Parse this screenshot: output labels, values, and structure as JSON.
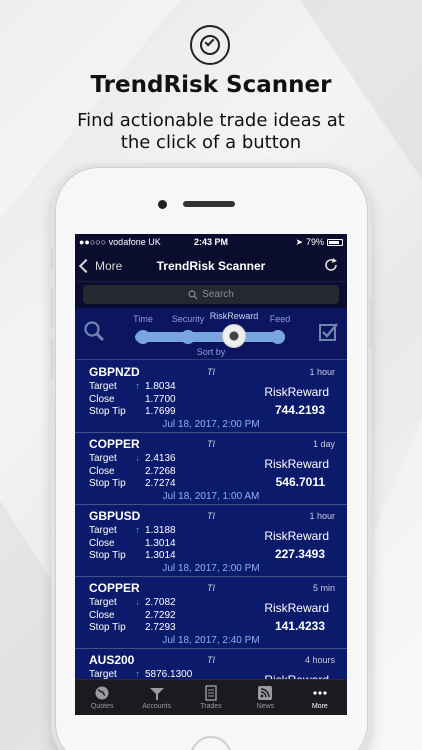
{
  "promo": {
    "title": "TrendRisk Scanner",
    "subtitle": "Find actionable trade ideas at the click of a button"
  },
  "status": {
    "carrier": "●●○○○ vodafone UK",
    "time": "2:43 PM",
    "battery": "79%"
  },
  "nav": {
    "back_label": "More",
    "title": "TrendRisk Scanner"
  },
  "search": {
    "placeholder": "Search"
  },
  "sort": {
    "options": [
      "Time",
      "Security",
      "RiskReward",
      "Feed"
    ],
    "selected": "RiskReward",
    "caption": "Sort by"
  },
  "trades": [
    {
      "name": "GBPNZD",
      "ti": "TI",
      "period": "1 hour",
      "direction": "up",
      "target_label": "Target",
      "target": "1.8034",
      "close_label": "Close",
      "close": "1.7700",
      "stop_label": "Stop Tip",
      "stop": "1.7699",
      "rr_label": "RiskReward",
      "rr": "744.2193",
      "date": "Jul 18, 2017, 2:00 PM"
    },
    {
      "name": "COPPER",
      "ti": "TI",
      "period": "1 day",
      "direction": "down",
      "target_label": "Target",
      "target": "2.4136",
      "close_label": "Close",
      "close": "2.7268",
      "stop_label": "Stop Tip",
      "stop": "2.7274",
      "rr_label": "RiskReward",
      "rr": "546.7011",
      "date": "Jul 18, 2017, 1:00 AM"
    },
    {
      "name": "GBPUSD",
      "ti": "TI",
      "period": "1 hour",
      "direction": "up",
      "target_label": "Target",
      "target": "1.3188",
      "close_label": "Close",
      "close": "1.3014",
      "stop_label": "Stop Tip",
      "stop": "1.3014",
      "rr_label": "RiskReward",
      "rr": "227.3493",
      "date": "Jul 18, 2017, 2:00 PM"
    },
    {
      "name": "COPPER",
      "ti": "TI",
      "period": "5 min",
      "direction": "down",
      "target_label": "Target",
      "target": "2.7082",
      "close_label": "Close",
      "close": "2.7292",
      "stop_label": "Stop Tip",
      "stop": "2.7293",
      "rr_label": "RiskReward",
      "rr": "141.4233",
      "date": "Jul 18, 2017, 2:40 PM"
    },
    {
      "name": "AUS200",
      "ti": "TI",
      "period": "4 hours",
      "direction": "up",
      "target_label": "Target",
      "target": "5876.1300",
      "close_label": "",
      "close": "",
      "stop_label": "",
      "stop": "",
      "rr_label": "RiskReward",
      "rr": "",
      "date": ""
    }
  ],
  "tabs": [
    {
      "label": "Quotes",
      "icon": "globe-icon"
    },
    {
      "label": "Accounts",
      "icon": "accounts-icon"
    },
    {
      "label": "Trades",
      "icon": "trades-icon"
    },
    {
      "label": "News",
      "icon": "rss-icon"
    },
    {
      "label": "More",
      "icon": "more-icon",
      "active": true
    }
  ],
  "colors": {
    "screen_bg": "#0b1a6b",
    "up": "#34c759",
    "down": "#e35050",
    "date": "#8fb0e8"
  }
}
